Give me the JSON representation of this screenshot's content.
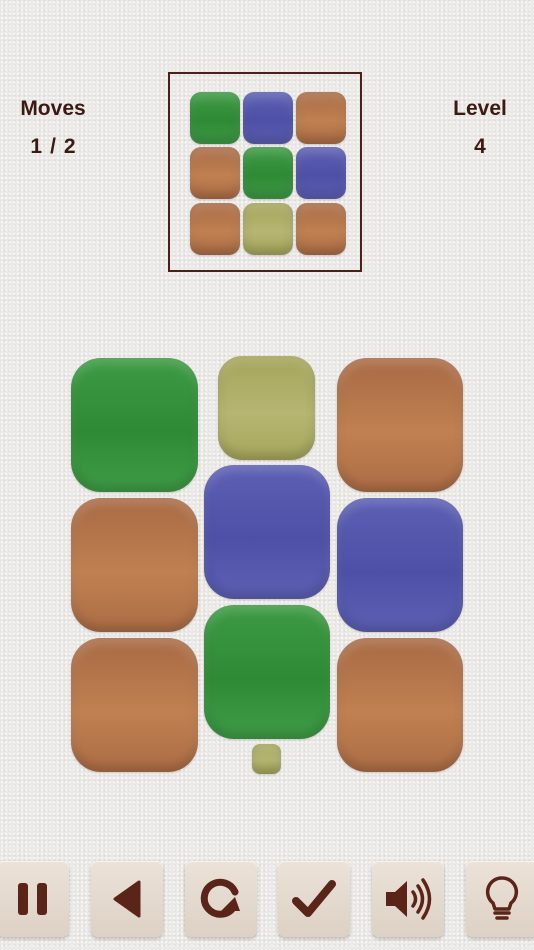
{
  "hud": {
    "moves": {
      "label": "Moves",
      "current": "1",
      "separator": "/",
      "total": "2"
    },
    "level": {
      "label": "Level",
      "value": "4"
    }
  },
  "colors": {
    "green": "#35923c",
    "blue": "#5356aa",
    "orange": "#b8784b",
    "olive": "#b0b06a",
    "text": "#3a1a12",
    "frame": "#4a2118"
  },
  "target_pattern": [
    [
      "green",
      "blue",
      "orange"
    ],
    [
      "orange",
      "green",
      "blue"
    ],
    [
      "orange",
      "olive",
      "orange"
    ]
  ],
  "board": {
    "columns": [
      {
        "tiles": [
          "green",
          "orange",
          "orange"
        ]
      },
      {
        "tiles": [
          "olive",
          "blue",
          "green",
          "olive"
        ]
      },
      {
        "tiles": [
          "orange",
          "blue",
          "orange"
        ]
      }
    ]
  },
  "toolbar": [
    {
      "name": "pause",
      "icon": "pause-icon"
    },
    {
      "name": "back",
      "icon": "back-arrow-icon"
    },
    {
      "name": "restart",
      "icon": "restart-icon"
    },
    {
      "name": "check",
      "icon": "checkmark-icon"
    },
    {
      "name": "sound",
      "icon": "speaker-icon"
    },
    {
      "name": "hint",
      "icon": "lightbulb-icon"
    }
  ]
}
